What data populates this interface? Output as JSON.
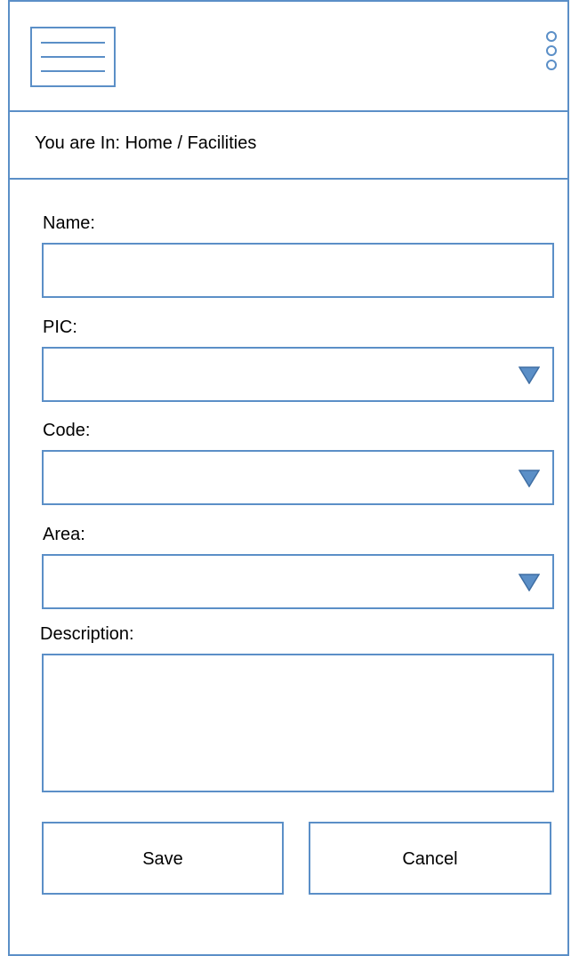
{
  "header": {
    "menu_icon": "hamburger-menu-icon",
    "more_icon": "vertical-dots-icon"
  },
  "breadcrumb": {
    "text": "You are In: Home / Facilities"
  },
  "form": {
    "name": {
      "label": "Name:",
      "value": ""
    },
    "pic": {
      "label": "PIC:",
      "value": ""
    },
    "code": {
      "label": "Code:",
      "value": ""
    },
    "area": {
      "label": "Area:",
      "value": ""
    },
    "description": {
      "label": "Description:",
      "value": ""
    },
    "dropdown_icon": "triangle-down-icon"
  },
  "actions": {
    "save_label": "Save",
    "cancel_label": "Cancel"
  },
  "colors": {
    "border": "#5b8fc7",
    "dropdown_fill": "#5b8fc7",
    "dropdown_stroke": "#3f6ea3",
    "background": "#ffffff"
  }
}
